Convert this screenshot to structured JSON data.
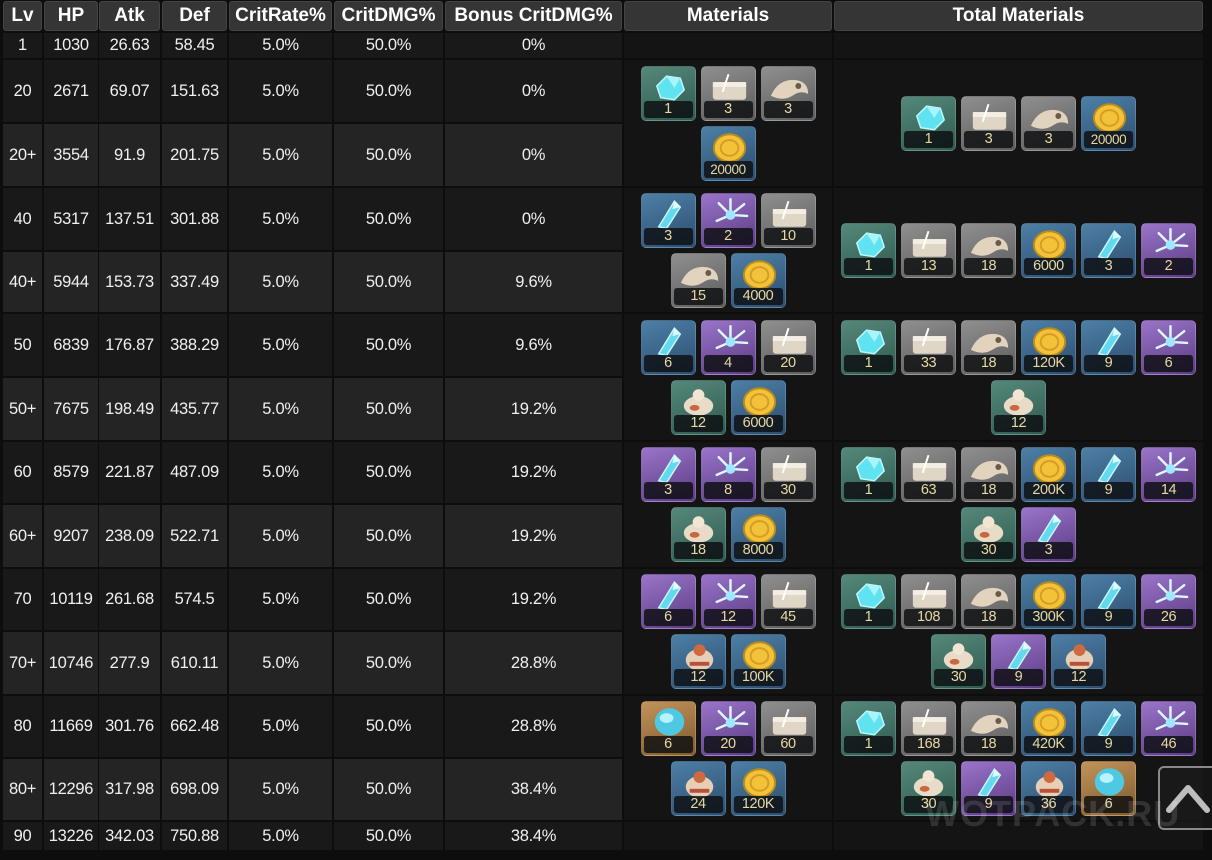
{
  "columns": [
    "Lv",
    "HP",
    "Atk",
    "Def",
    "CritRate%",
    "CritDMG%",
    "Bonus CritDMG%",
    "Materials",
    "Total Materials"
  ],
  "rows": [
    [
      "1",
      "1030",
      "26.63",
      "58.45",
      "5.0%",
      "50.0%",
      "0%"
    ],
    [
      "20",
      "2671",
      "69.07",
      "151.63",
      "5.0%",
      "50.0%",
      "0%"
    ],
    [
      "20+",
      "3554",
      "91.9",
      "201.75",
      "5.0%",
      "50.0%",
      "0%"
    ],
    [
      "40",
      "5317",
      "137.51",
      "301.88",
      "5.0%",
      "50.0%",
      "0%"
    ],
    [
      "40+",
      "5944",
      "153.73",
      "337.49",
      "5.0%",
      "50.0%",
      "9.6%"
    ],
    [
      "50",
      "6839",
      "176.87",
      "388.29",
      "5.0%",
      "50.0%",
      "9.6%"
    ],
    [
      "50+",
      "7675",
      "198.49",
      "435.77",
      "5.0%",
      "50.0%",
      "19.2%"
    ],
    [
      "60",
      "8579",
      "221.87",
      "487.09",
      "5.0%",
      "50.0%",
      "19.2%"
    ],
    [
      "60+",
      "9207",
      "238.09",
      "522.71",
      "5.0%",
      "50.0%",
      "19.2%"
    ],
    [
      "70",
      "10119",
      "261.68",
      "574.5",
      "5.0%",
      "50.0%",
      "19.2%"
    ],
    [
      "70+",
      "10746",
      "277.9",
      "610.11",
      "5.0%",
      "50.0%",
      "28.8%"
    ],
    [
      "80",
      "11669",
      "301.76",
      "662.48",
      "5.0%",
      "50.0%",
      "28.8%"
    ],
    [
      "80+",
      "12296",
      "317.98",
      "698.09",
      "5.0%",
      "50.0%",
      "38.4%"
    ],
    [
      "90",
      "13226",
      "342.03",
      "750.88",
      "5.0%",
      "50.0%",
      "38.4%"
    ]
  ],
  "materials": [
    {
      "rows": [
        [
          {
            "icon": "crystal-chunk-icon",
            "q": 2,
            "count": "1"
          },
          {
            "icon": "metal-scrap-icon",
            "q": 1,
            "count": "3"
          },
          {
            "icon": "horn-fragment-icon",
            "q": 1,
            "count": "3"
          }
        ],
        [
          {
            "icon": "coin-icon",
            "q": 3,
            "count": "20000"
          }
        ]
      ]
    },
    {
      "rows": [
        [
          {
            "icon": "crystal-shard-icon",
            "q": 3,
            "count": "3"
          },
          {
            "icon": "energy-burst-icon",
            "q": 4,
            "count": "2"
          },
          {
            "icon": "metal-scrap-icon",
            "q": 1,
            "count": "10"
          }
        ],
        [
          {
            "icon": "horn-fragment-icon",
            "q": 1,
            "count": "15"
          },
          {
            "icon": "coin-icon",
            "q": 3,
            "count": "4000"
          }
        ]
      ]
    },
    {
      "rows": [
        [
          {
            "icon": "crystal-shard-icon",
            "q": 3,
            "count": "6"
          },
          {
            "icon": "energy-burst-icon",
            "q": 4,
            "count": "4"
          },
          {
            "icon": "metal-scrap-icon",
            "q": 1,
            "count": "20"
          }
        ],
        [
          {
            "icon": "shell-creature-icon",
            "q": 2,
            "count": "12"
          },
          {
            "icon": "coin-icon",
            "q": 3,
            "count": "6000"
          }
        ]
      ]
    },
    {
      "rows": [
        [
          {
            "icon": "crystal-shard-icon",
            "q": 4,
            "count": "3"
          },
          {
            "icon": "energy-burst-icon",
            "q": 4,
            "count": "8"
          },
          {
            "icon": "metal-scrap-icon",
            "q": 1,
            "count": "30"
          }
        ],
        [
          {
            "icon": "shell-creature-icon",
            "q": 2,
            "count": "18"
          },
          {
            "icon": "coin-icon",
            "q": 3,
            "count": "8000"
          }
        ]
      ]
    },
    {
      "rows": [
        [
          {
            "icon": "crystal-shard-icon",
            "q": 4,
            "count": "6"
          },
          {
            "icon": "energy-burst-icon",
            "q": 4,
            "count": "12"
          },
          {
            "icon": "metal-scrap-icon",
            "q": 1,
            "count": "45"
          }
        ],
        [
          {
            "icon": "beast-pod-icon",
            "q": 3,
            "count": "12"
          },
          {
            "icon": "coin-icon",
            "q": 3,
            "count": "100K"
          }
        ]
      ]
    },
    {
      "rows": [
        [
          {
            "icon": "crystal-orb-icon",
            "q": 5,
            "count": "6"
          },
          {
            "icon": "energy-burst-icon",
            "q": 4,
            "count": "20"
          },
          {
            "icon": "metal-scrap-icon",
            "q": 1,
            "count": "60"
          }
        ],
        [
          {
            "icon": "beast-pod-icon",
            "q": 3,
            "count": "24"
          },
          {
            "icon": "coin-icon",
            "q": 3,
            "count": "120K"
          }
        ]
      ]
    }
  ],
  "totals": [
    {
      "rows": [
        [
          {
            "icon": "crystal-chunk-icon",
            "q": 2,
            "count": "1"
          },
          {
            "icon": "metal-scrap-icon",
            "q": 1,
            "count": "3"
          },
          {
            "icon": "horn-fragment-icon",
            "q": 1,
            "count": "3"
          },
          {
            "icon": "coin-icon",
            "q": 3,
            "count": "20000"
          }
        ]
      ]
    },
    {
      "rows": [
        [
          {
            "icon": "crystal-chunk-icon",
            "q": 2,
            "count": "1"
          },
          {
            "icon": "metal-scrap-icon",
            "q": 1,
            "count": "13"
          },
          {
            "icon": "horn-fragment-icon",
            "q": 1,
            "count": "18"
          },
          {
            "icon": "coin-icon",
            "q": 3,
            "count": "6000"
          },
          {
            "icon": "crystal-shard-icon",
            "q": 3,
            "count": "3"
          },
          {
            "icon": "energy-burst-icon",
            "q": 4,
            "count": "2"
          }
        ]
      ]
    },
    {
      "rows": [
        [
          {
            "icon": "crystal-chunk-icon",
            "q": 2,
            "count": "1"
          },
          {
            "icon": "metal-scrap-icon",
            "q": 1,
            "count": "33"
          },
          {
            "icon": "horn-fragment-icon",
            "q": 1,
            "count": "18"
          },
          {
            "icon": "coin-icon",
            "q": 3,
            "count": "120K"
          },
          {
            "icon": "crystal-shard-icon",
            "q": 3,
            "count": "9"
          },
          {
            "icon": "energy-burst-icon",
            "q": 4,
            "count": "6"
          }
        ],
        [
          {
            "icon": "shell-creature-icon",
            "q": 2,
            "count": "12"
          }
        ]
      ]
    },
    {
      "rows": [
        [
          {
            "icon": "crystal-chunk-icon",
            "q": 2,
            "count": "1"
          },
          {
            "icon": "metal-scrap-icon",
            "q": 1,
            "count": "63"
          },
          {
            "icon": "horn-fragment-icon",
            "q": 1,
            "count": "18"
          },
          {
            "icon": "coin-icon",
            "q": 3,
            "count": "200K"
          },
          {
            "icon": "crystal-shard-icon",
            "q": 3,
            "count": "9"
          },
          {
            "icon": "energy-burst-icon",
            "q": 4,
            "count": "14"
          }
        ],
        [
          {
            "icon": "shell-creature-icon",
            "q": 2,
            "count": "30"
          },
          {
            "icon": "crystal-shard-icon",
            "q": 4,
            "count": "3"
          }
        ]
      ]
    },
    {
      "rows": [
        [
          {
            "icon": "crystal-chunk-icon",
            "q": 2,
            "count": "1"
          },
          {
            "icon": "metal-scrap-icon",
            "q": 1,
            "count": "108"
          },
          {
            "icon": "horn-fragment-icon",
            "q": 1,
            "count": "18"
          },
          {
            "icon": "coin-icon",
            "q": 3,
            "count": "300K"
          },
          {
            "icon": "crystal-shard-icon",
            "q": 3,
            "count": "9"
          },
          {
            "icon": "energy-burst-icon",
            "q": 4,
            "count": "26"
          }
        ],
        [
          {
            "icon": "shell-creature-icon",
            "q": 2,
            "count": "30"
          },
          {
            "icon": "crystal-shard-icon",
            "q": 4,
            "count": "9"
          },
          {
            "icon": "beast-pod-icon",
            "q": 3,
            "count": "12"
          }
        ]
      ]
    },
    {
      "rows": [
        [
          {
            "icon": "crystal-chunk-icon",
            "q": 2,
            "count": "1"
          },
          {
            "icon": "metal-scrap-icon",
            "q": 1,
            "count": "168"
          },
          {
            "icon": "horn-fragment-icon",
            "q": 1,
            "count": "18"
          },
          {
            "icon": "coin-icon",
            "q": 3,
            "count": "420K"
          },
          {
            "icon": "crystal-shard-icon",
            "q": 3,
            "count": "9"
          },
          {
            "icon": "energy-burst-icon",
            "q": 4,
            "count": "46"
          }
        ],
        [
          {
            "icon": "shell-creature-icon",
            "q": 2,
            "count": "30"
          },
          {
            "icon": "crystal-shard-icon",
            "q": 4,
            "count": "9"
          },
          {
            "icon": "beast-pod-icon",
            "q": 3,
            "count": "36"
          },
          {
            "icon": "crystal-orb-icon",
            "q": 5,
            "count": "6"
          }
        ]
      ]
    }
  ],
  "watermark": "WOTPACK.RU",
  "scroll_top_icon": "chevron-up-icon"
}
